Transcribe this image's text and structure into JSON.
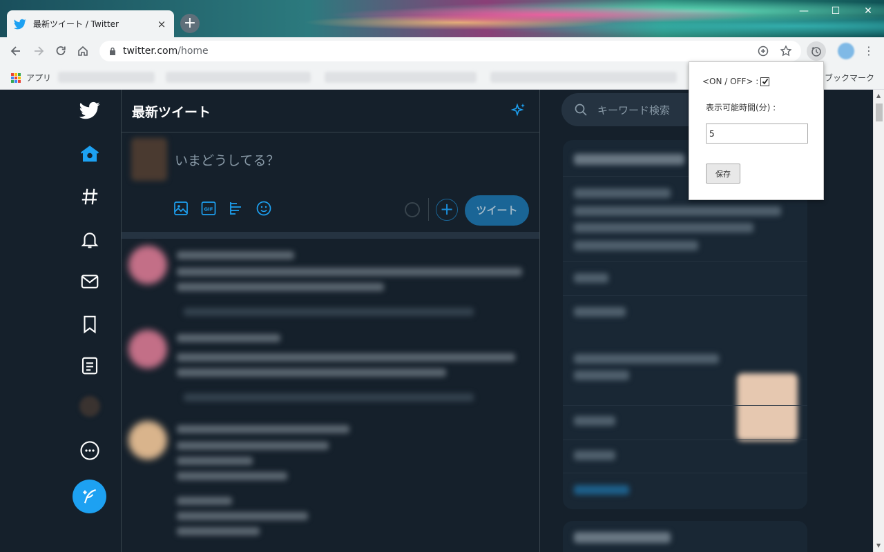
{
  "browser": {
    "tab_title": "最新ツイート / Twitter",
    "tab_close": "×",
    "new_tab": "+",
    "url_domain": "twitter.com",
    "url_path": "/home",
    "apps_label": "アプリ",
    "other_bookmarks": "他のブックマーク",
    "window_controls": [
      "—",
      "☐",
      "✕"
    ]
  },
  "twitter": {
    "header_title": "最新ツイート",
    "compose_placeholder": "いまどうしてる？",
    "tweet_button": "ツイート",
    "search_placeholder": "キーワード検索",
    "nav_items": [
      "home",
      "explore",
      "notifications",
      "messages",
      "bookmarks",
      "lists",
      "profile",
      "more"
    ]
  },
  "popup": {
    "on_off_label": "<ON / OFF> :",
    "on_off_checked": true,
    "time_label": "表示可能時間(分) :",
    "time_value": "5",
    "save_button": "保存"
  },
  "colors": {
    "twitter_blue": "#1da1f2",
    "bg_dark": "#15202b",
    "border": "#38444d",
    "muted": "#8899a6"
  }
}
